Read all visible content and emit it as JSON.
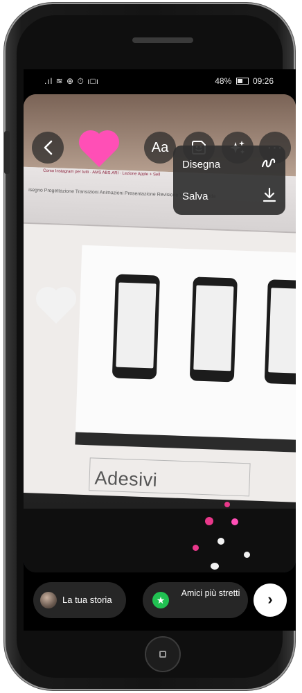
{
  "status_bar": {
    "left_icons": ".ıl ≋ ⊕ ⏱ ı□ı",
    "battery": "48%",
    "time": "09:26"
  },
  "editor": {
    "text_tool_label": "Aa",
    "more_label": "···"
  },
  "menu": {
    "items": [
      {
        "label": "Disegna",
        "icon": "draw-squiggle-icon"
      },
      {
        "label": "Salva",
        "icon": "download-icon"
      }
    ]
  },
  "photo": {
    "slide_text": "Adesivi",
    "ribbon_title": "Corso Instagram per tutti · AMS ABS.ARI · Lezione Apple + Sell",
    "ribbon_tabs": "isegno  Progettazione  Transizioni  Animazioni  Presentazione  Revisione  Visualizza  Guida",
    "sticker_colors": [
      "#ff4fb6",
      "#f2f2f2",
      "#e8388a"
    ]
  },
  "bottom": {
    "your_story_label": "La tua storia",
    "close_friends_label": "Amici più stretti",
    "next_icon": "chevron-right-icon"
  }
}
